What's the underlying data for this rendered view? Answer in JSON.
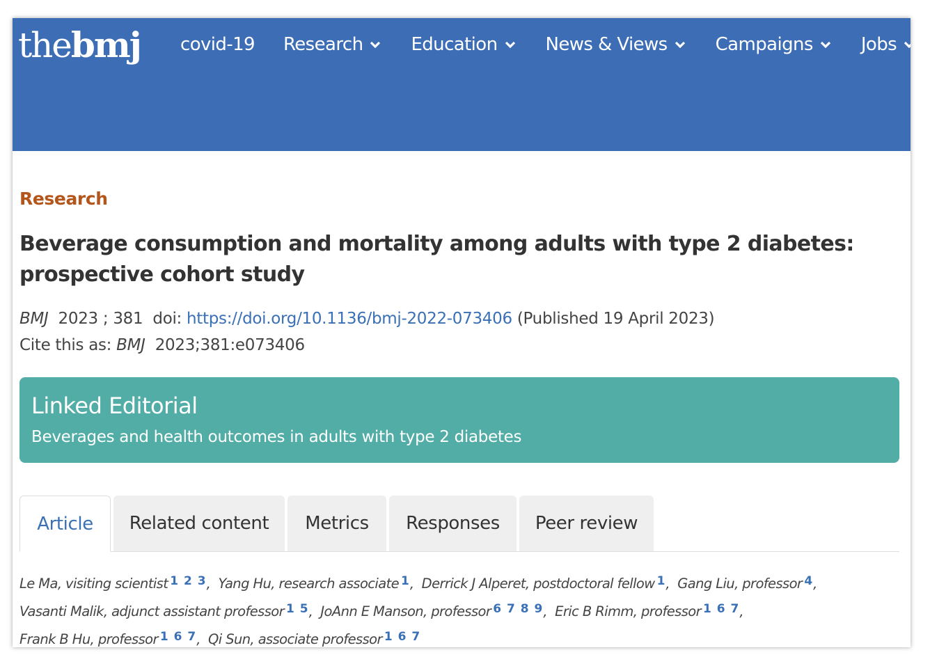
{
  "nav": {
    "logo_thin": "the",
    "logo_bold": "bmj",
    "items": [
      {
        "label": "covid-19",
        "has_dropdown": false
      },
      {
        "label": "Research",
        "has_dropdown": true
      },
      {
        "label": "Education",
        "has_dropdown": true
      },
      {
        "label": "News & Views",
        "has_dropdown": true
      },
      {
        "label": "Campaigns",
        "has_dropdown": true
      },
      {
        "label": "Jobs",
        "has_dropdown": true
      }
    ]
  },
  "article": {
    "category": "Research",
    "title": "Beverage consumption and mortality among adults with type 2 diabetes: prospective cohort study",
    "journal": "BMJ",
    "year_vol": "2023 ; 381",
    "doi_label": "doi:",
    "doi_url": "https://doi.org/10.1136/bmj-2022-073406",
    "published": "(Published 19 April 2023)",
    "cite_label": "Cite this as:",
    "cite_value": "2023;381:e073406"
  },
  "editorial": {
    "heading": "Linked Editorial",
    "subtitle": "Beverages and health outcomes in adults with type 2 diabetes"
  },
  "tabs": [
    {
      "label": "Article",
      "active": true
    },
    {
      "label": "Related content",
      "active": false
    },
    {
      "label": "Metrics",
      "active": false
    },
    {
      "label": "Responses",
      "active": false
    },
    {
      "label": "Peer review",
      "active": false
    }
  ],
  "authors": [
    {
      "name": "Le Ma, visiting scientist",
      "aff": "1 2 3"
    },
    {
      "name": "Yang Hu, research associate",
      "aff": "1"
    },
    {
      "name": "Derrick J Alperet, postdoctoral fellow",
      "aff": "1"
    },
    {
      "name": "Gang Liu, professor",
      "aff": "4"
    },
    {
      "name": "Vasanti Malik, adjunct assistant professor",
      "aff": "1 5"
    },
    {
      "name": "JoAnn E Manson, professor",
      "aff": "6 7 8 9"
    },
    {
      "name": "Eric B Rimm, professor",
      "aff": "1 6 7"
    },
    {
      "name": "Frank B Hu, professor",
      "aff": "1 6 7"
    },
    {
      "name": "Qi Sun, associate professor",
      "aff": "1 6 7"
    }
  ],
  "colors": {
    "nav_bg": "#3d6db5",
    "category": "#b4561c",
    "link": "#3a70b6",
    "editorial_bg": "#51ada5"
  }
}
